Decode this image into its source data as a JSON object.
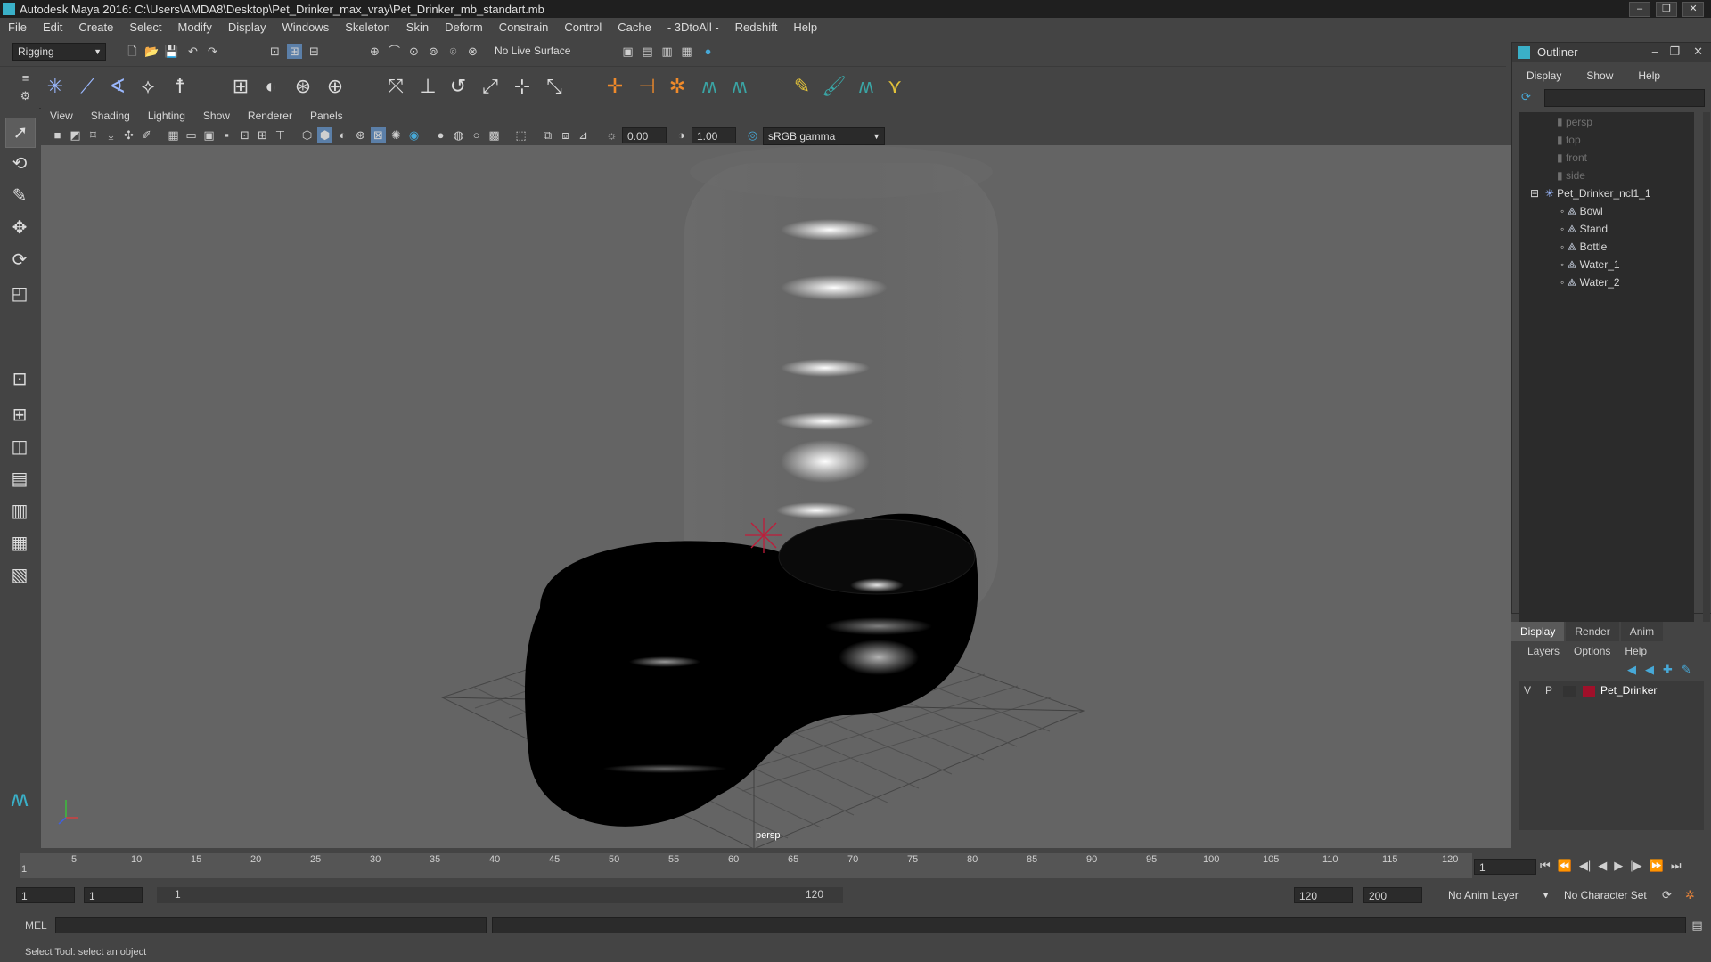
{
  "window": {
    "title": "Autodesk Maya 2016: C:\\Users\\AMDA8\\Desktop\\Pet_Drinker_max_vray\\Pet_Drinker_mb_standart.mb",
    "buttons": [
      "–",
      "❐",
      "✕"
    ]
  },
  "menubar": [
    "File",
    "Edit",
    "Create",
    "Select",
    "Modify",
    "Display",
    "Windows",
    "Skeleton",
    "Skin",
    "Deform",
    "Constrain",
    "Control",
    "Cache",
    "- 3DtoAll -",
    "Redshift",
    "Help"
  ],
  "statusline": {
    "menuset": "Rigging",
    "live_surface": "No Live Surface"
  },
  "viewport": {
    "menus": [
      "View",
      "Shading",
      "Lighting",
      "Show",
      "Renderer",
      "Panels"
    ],
    "exposure": "0.00",
    "gamma": "1.00",
    "color_space": "sRGB gamma",
    "camera_label": "persp"
  },
  "outliner": {
    "title": "Outliner",
    "menus": [
      "Display",
      "Show",
      "Help"
    ],
    "items": [
      {
        "label": "persp",
        "dim": true
      },
      {
        "label": "top",
        "dim": true
      },
      {
        "label": "front",
        "dim": true
      },
      {
        "label": "side",
        "dim": true
      },
      {
        "label": "Pet_Drinker_ncl1_1",
        "dim": false
      },
      {
        "label": "Bowl",
        "dim": false
      },
      {
        "label": "Stand",
        "dim": false
      },
      {
        "label": "Bottle",
        "dim": false
      },
      {
        "label": "Water_1",
        "dim": false
      },
      {
        "label": "Water_2",
        "dim": false
      }
    ]
  },
  "layers": {
    "tabs": [
      "Display",
      "Render",
      "Anim"
    ],
    "active_tab": "Display",
    "menus": [
      "Layers",
      "Options",
      "Help"
    ],
    "rows": [
      {
        "v": "V",
        "p": "P",
        "name": "Pet_Drinker",
        "color": "#a0102a"
      }
    ]
  },
  "timeline": {
    "ticks": [
      "5",
      "10",
      "15",
      "20",
      "25",
      "30",
      "35",
      "40",
      "45",
      "50",
      "55",
      "60",
      "65",
      "70",
      "75",
      "80",
      "85",
      "90",
      "95",
      "100",
      "105",
      "110",
      "115",
      "120"
    ],
    "first_tick": "1",
    "current_frame": "1"
  },
  "range": {
    "start": "1",
    "playback_start": "1",
    "slider_start": "1",
    "slider_end": "120",
    "playback_end": "120",
    "end": "200",
    "anim_layer": "No Anim Layer",
    "character_set": "No Character Set"
  },
  "command": {
    "language": "MEL"
  },
  "help_line": "Select Tool: select an object",
  "colors": {
    "viewport_bg": "#646464",
    "ui_bg": "#444444",
    "accent": "#3ab0c8",
    "layer_color": "#a0102a"
  }
}
